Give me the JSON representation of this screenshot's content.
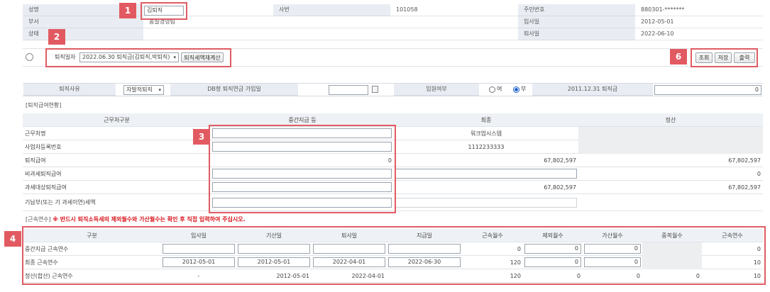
{
  "employee": {
    "name_label": "성명",
    "name_value": "김퇴직",
    "empno_label": "사번",
    "empno_value": "101058",
    "rrn_label": "주민번호",
    "rrn_value": "880301-*******",
    "dept_label": "부서",
    "dept_value": "품질경영팀",
    "hire_label": "입사일",
    "hire_value": "2012-05-01",
    "position_label": "상태",
    "position_value": "",
    "retire_label": "퇴사일",
    "retire_value": "2022-06-10"
  },
  "toolbar": {
    "retire_date_label": "퇴직일자",
    "retire_date_select": "2022.06.30 퇴직금(김퇴직,박퇴직)",
    "recalc_button": "퇴직세액재계산",
    "search_button": "조회",
    "save_button": "저장",
    "print_button": "출력"
  },
  "options": {
    "reason_label": "퇴직사유",
    "reason_value": "자발적퇴직",
    "db_label": "DB형 퇴직연금 가입일",
    "db_value": "",
    "exec_label": "임원여부",
    "exec_yes": "여",
    "exec_no": "부",
    "pay2011_label": "2011.12.31 퇴직금",
    "pay2011_value": "0"
  },
  "pay_section": {
    "title": "[퇴직급여현황]",
    "headers": [
      "근무처구분",
      "중간지급 등",
      "최종",
      "정산"
    ],
    "rows": [
      {
        "label": "근무처명",
        "mid": "",
        "final": "워크업시스템",
        "settle": ""
      },
      {
        "label": "사업자등록번호",
        "mid": "",
        "final": "1112233333",
        "settle": ""
      },
      {
        "label": "퇴직급여",
        "mid": "0",
        "final": "67,802,597",
        "settle": "67,802,597"
      },
      {
        "label": "비과세퇴직급여",
        "mid": "",
        "final": "",
        "settle": "0"
      },
      {
        "label": "과세대상퇴직급여",
        "mid": "",
        "final": "67,802,597",
        "settle": "67,802,597"
      },
      {
        "label": "기납부(또는 기 과세이연)세액",
        "mid": "",
        "final": "",
        "settle": ""
      }
    ]
  },
  "service_section": {
    "title": "[근속연수]",
    "notice": "※ 반드시 퇴직소득세의 제외월수와 가산월수는 확인 후 직접 입력하여 주십시오.",
    "headers": [
      "구분",
      "입사일",
      "기산일",
      "퇴사일",
      "지급일",
      "근속월수",
      "제외월수",
      "가산월수",
      "중복월수",
      "근속연수"
    ],
    "rows": [
      {
        "label": "중간지급 근속연수",
        "hire": "",
        "start": "",
        "retire": "",
        "pay": "",
        "months": "0",
        "excl": "0",
        "add": "0",
        "dup": "",
        "years": "0"
      },
      {
        "label": "최종 근속연수",
        "hire": "2012-05-01",
        "start": "2012-05-01",
        "retire": "2022-04-01",
        "pay": "2022-06-30",
        "months": "120",
        "excl": "0",
        "add": "0",
        "dup": "",
        "years": "10"
      },
      {
        "label": "정산(합산) 근속연수",
        "hire": "-",
        "start": "2012-05-01",
        "retire": "2022-04-01",
        "pay": "",
        "months": "120",
        "excl": "0",
        "add": "0",
        "dup": "0",
        "years": "10"
      }
    ]
  },
  "badges": [
    "1",
    "2",
    "3",
    "4",
    "6"
  ]
}
